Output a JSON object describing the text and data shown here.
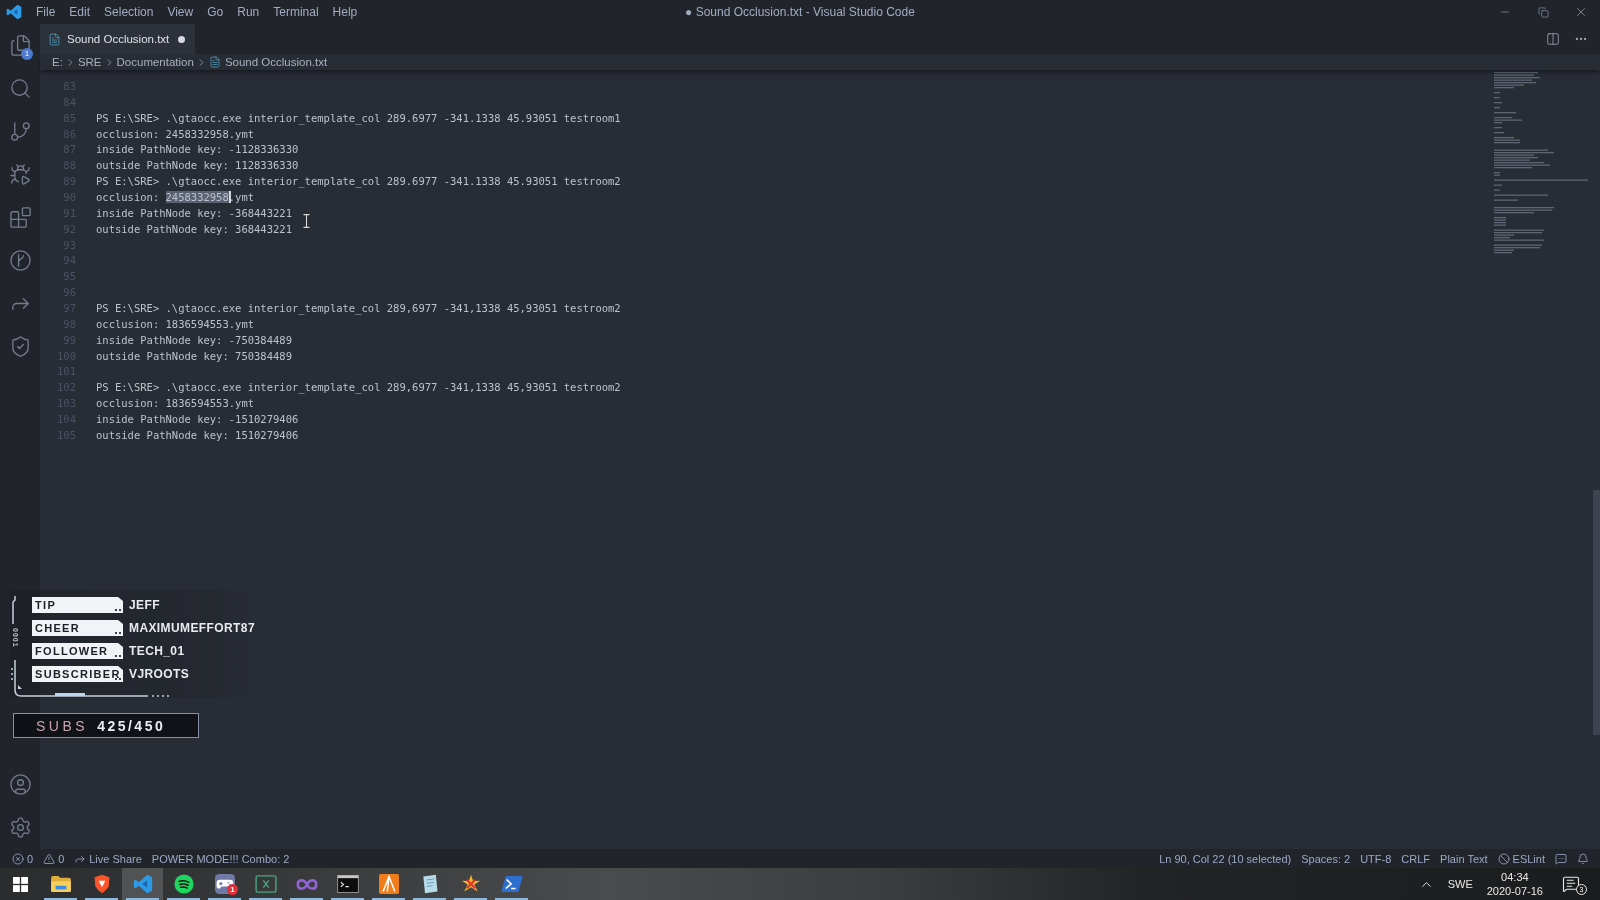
{
  "window": {
    "title": "● Sound Occlusion.txt - Visual Studio Code"
  },
  "menu": [
    "File",
    "Edit",
    "Selection",
    "View",
    "Go",
    "Run",
    "Terminal",
    "Help"
  ],
  "activity_bar": {
    "top": [
      {
        "kind": "files",
        "badge": "1"
      },
      {
        "kind": "search"
      },
      {
        "kind": "branch"
      },
      {
        "kind": "debug"
      },
      {
        "kind": "extensions"
      },
      {
        "kind": "history"
      },
      {
        "kind": "share"
      },
      {
        "kind": "shield"
      }
    ],
    "bottom": [
      {
        "kind": "account"
      },
      {
        "kind": "settings"
      }
    ]
  },
  "tabs": [
    {
      "label": "Sound Occlusion.txt",
      "selected": true,
      "modified": true
    }
  ],
  "breadcrumbs": [
    {
      "label": "E:",
      "kind": "folder"
    },
    {
      "label": "SRE",
      "kind": "folder"
    },
    {
      "label": "Documentation",
      "kind": "folder"
    },
    {
      "label": "Sound Occlusion.txt",
      "kind": "file"
    }
  ],
  "editor": {
    "lines": [
      {
        "number": "83",
        "cursor": false
      },
      {
        "number": "84",
        "cursor": false
      },
      {
        "number": "85",
        "cursor": false,
        "segments": [
          {
            "text": "PS E:\\SRE> .\\gtaocc.exe interior_template_col 289.6977 -341.1338 45.93051 testroom1",
            "selected": false
          }
        ]
      },
      {
        "number": "86",
        "cursor": false,
        "segments": [
          {
            "text": "occlusion: 2458332958.ymt",
            "selected": false
          }
        ]
      },
      {
        "number": "87",
        "cursor": false,
        "segments": [
          {
            "text": "inside PathNode key: -1128336330",
            "selected": false
          }
        ]
      },
      {
        "number": "88",
        "cursor": false,
        "segments": [
          {
            "text": "outside PathNode key: 1128336330",
            "selected": false
          }
        ]
      },
      {
        "number": "89",
        "cursor": false,
        "segments": [
          {
            "text": "PS E:\\SRE> .\\gtaocc.exe interior_template_col 289.6977 -341.1338 45.93051 testroom2",
            "selected": false
          }
        ]
      },
      {
        "number": "90",
        "cursor": true,
        "segments": [
          {
            "text": "occlusion: ",
            "selected": false
          },
          {
            "text": "2458332958",
            "selected": true
          },
          {
            "text": ".ymt",
            "selected": false
          }
        ]
      },
      {
        "number": "91",
        "cursor": false,
        "segments": [
          {
            "text": "inside PathNode key: -368443221",
            "selected": false
          }
        ]
      },
      {
        "number": "92",
        "cursor": false,
        "segments": [
          {
            "text": "outside PathNode key: 368443221",
            "selected": false
          }
        ]
      },
      {
        "number": "93",
        "cursor": false
      },
      {
        "number": "94",
        "cursor": false
      },
      {
        "number": "95",
        "cursor": false
      },
      {
        "number": "96",
        "cursor": false
      },
      {
        "number": "97",
        "cursor": false,
        "segments": [
          {
            "text": "PS E:\\SRE> .\\gtaocc.exe interior_template_col 289,6977 -341,1338 45,93051 testroom2",
            "selected": false
          }
        ]
      },
      {
        "number": "98",
        "cursor": false,
        "segments": [
          {
            "text": "occlusion: 1836594553.ymt",
            "selected": false
          }
        ]
      },
      {
        "number": "99",
        "cursor": false,
        "segments": [
          {
            "text": "inside PathNode key: -750384489",
            "selected": false
          }
        ]
      },
      {
        "number": "100",
        "cursor": false,
        "segments": [
          {
            "text": "outside PathNode key: 750384489",
            "selected": false
          }
        ]
      },
      {
        "number": "101",
        "cursor": false
      },
      {
        "number": "102",
        "cursor": false,
        "segments": [
          {
            "text": "PS E:\\SRE> .\\gtaocc.exe interior_template_col 289,6977 -341,1338 45,93051 testroom2",
            "selected": false
          }
        ]
      },
      {
        "number": "103",
        "cursor": false,
        "segments": [
          {
            "text": "occlusion: 1836594553.ymt",
            "selected": false
          }
        ]
      },
      {
        "number": "104",
        "cursor": false,
        "segments": [
          {
            "text": "inside PathNode key: -1510279406",
            "selected": false
          }
        ]
      },
      {
        "number": "105",
        "cursor": false,
        "segments": [
          {
            "text": "outside PathNode key: 1510279406",
            "selected": false
          }
        ]
      }
    ]
  },
  "stream_overlay": {
    "counter": "0001",
    "events": [
      {
        "label": "TIP",
        "name": "JEFF"
      },
      {
        "label": "CHEER",
        "name": "MAXIMUMEFFORT87"
      },
      {
        "label": "FOLLOWER",
        "name": "TECH_01"
      },
      {
        "label": "SUBSCRIBER",
        "name": "VJROOTS"
      }
    ],
    "goal": {
      "label": "SUBS",
      "value": "425/450"
    }
  },
  "status_bar": {
    "left": [
      {
        "kind": "errors",
        "text": "0"
      },
      {
        "kind": "warnings",
        "text": "0"
      },
      {
        "kind": "share",
        "text": "Live Share"
      },
      {
        "kind": "text",
        "text": "POWER MODE!!! Combo: 2"
      }
    ],
    "right": [
      {
        "kind": "text",
        "text": "Ln 90, Col 22 (10 selected)"
      },
      {
        "kind": "text",
        "text": "Spaces: 2"
      },
      {
        "kind": "text",
        "text": "UTF-8"
      },
      {
        "kind": "text",
        "text": "CRLF"
      },
      {
        "kind": "text",
        "text": "Plain Text"
      },
      {
        "kind": "blocked",
        "text": "ESLint"
      },
      {
        "kind": "feedback"
      },
      {
        "kind": "bell"
      }
    ]
  },
  "taskbar": {
    "apps": [
      {
        "kind": "folder",
        "running": true,
        "selected": false
      },
      {
        "kind": "shield",
        "running": true,
        "selected": false
      },
      {
        "kind": "ribbon",
        "running": true,
        "selected": true
      },
      {
        "kind": "waves",
        "running": true,
        "selected": false
      },
      {
        "kind": "gamepad",
        "running": true,
        "selected": false,
        "badge": "1"
      },
      {
        "kind": "crossbox",
        "running": true,
        "selected": false
      },
      {
        "kind": "infinity",
        "running": true,
        "selected": false
      },
      {
        "kind": "console",
        "running": true,
        "selected": false
      },
      {
        "kind": "peak",
        "running": true,
        "selected": false
      },
      {
        "kind": "page",
        "running": true,
        "selected": false
      },
      {
        "kind": "starburst",
        "running": true,
        "selected": false
      },
      {
        "kind": "prompt",
        "running": true,
        "selected": false
      }
    ],
    "tray": {
      "language": "SWE",
      "time": "04:34",
      "date": "2020-07-16",
      "notifications": "3"
    }
  }
}
